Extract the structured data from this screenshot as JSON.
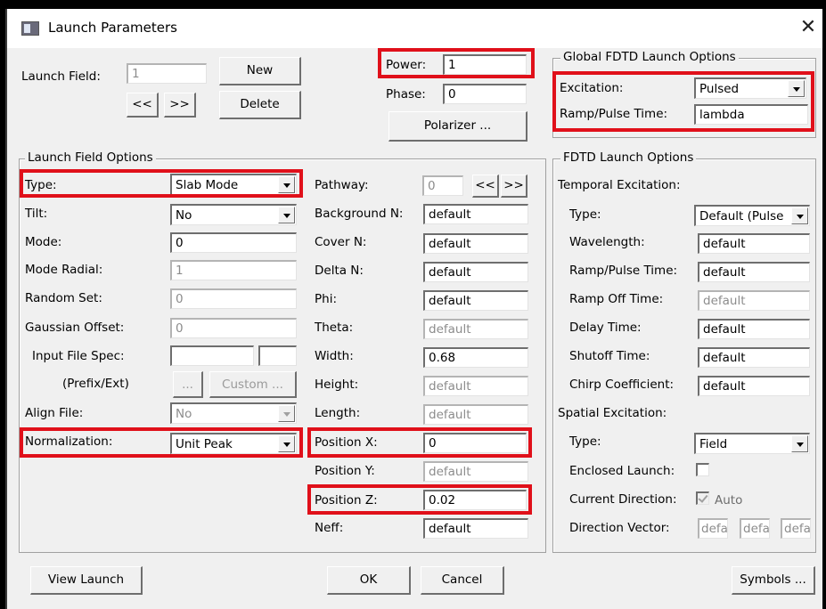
{
  "window": {
    "title": "Launch Parameters",
    "close_symbol": "✕"
  },
  "launch": {
    "field_label": "Launch Field:",
    "field_value": "1",
    "new_label": "New",
    "delete_label": "Delete",
    "prev_label": "<<",
    "next_label": ">>"
  },
  "power": {
    "label": "Power:",
    "value": "1"
  },
  "phase": {
    "label": "Phase:",
    "value": "0"
  },
  "polarizer_label": "Polarizer ...",
  "global_fdtd": {
    "title": "Global FDTD Launch Options",
    "excitation_label": "Excitation:",
    "excitation_value": "Pulsed",
    "ramp_label": "Ramp/Pulse Time:",
    "ramp_value": "lambda"
  },
  "lfo": {
    "title": "Launch Field Options",
    "type_label": "Type:",
    "type_value": "Slab Mode",
    "tilt_label": "Tilt:",
    "tilt_value": "No",
    "mode_label": "Mode:",
    "mode_value": "0",
    "mode_radial_label": "Mode Radial:",
    "mode_radial_value": "1",
    "random_set_label": "Random Set:",
    "random_set_value": "0",
    "gaussian_offset_label": "Gaussian Offset:",
    "gaussian_offset_value": "0",
    "input_file_label": "Input File Spec:",
    "prefix_ext_label": "(Prefix/Ext)",
    "ellipsis_label": "...",
    "custom_label": "Custom ...",
    "align_file_label": "Align File:",
    "align_file_value": "No",
    "normalization_label": "Normalization:",
    "normalization_value": "Unit Peak",
    "pathway_label": "Pathway:",
    "pathway_value": "0",
    "pathway_prev": "<<",
    "pathway_next": ">>",
    "background_n_label": "Background N:",
    "background_n_value": "default",
    "cover_n_label": "Cover N:",
    "cover_n_value": "default",
    "delta_n_label": "Delta N:",
    "delta_n_value": "default",
    "phi_label": "Phi:",
    "phi_value": "default",
    "theta_label": "Theta:",
    "theta_value": "default",
    "width_label": "Width:",
    "width_value": "0.68",
    "height_label": "Height:",
    "height_value": "default",
    "length_label": "Length:",
    "length_value": "default",
    "position_x_label": "Position X:",
    "position_x_value": "0",
    "position_y_label": "Position Y:",
    "position_y_value": "default",
    "position_z_label": "Position Z:",
    "position_z_value": "0.02",
    "neff_label": "Neff:",
    "neff_value": "default"
  },
  "fdtd": {
    "title": "FDTD Launch Options",
    "temporal_label": "Temporal Excitation:",
    "t_type_label": "Type:",
    "t_type_value": "Default (Pulse",
    "wavelength_label": "Wavelength:",
    "wavelength_value": "default",
    "ramp_pulse_label": "Ramp/Pulse Time:",
    "ramp_pulse_value": "default",
    "ramp_off_label": "Ramp Off Time:",
    "ramp_off_value": "default",
    "delay_label": "Delay Time:",
    "delay_value": "default",
    "shutoff_label": "Shutoff Time:",
    "shutoff_value": "default",
    "chirp_label": "Chirp Coefficient:",
    "chirp_value": "default",
    "spatial_label": "Spatial Excitation:",
    "s_type_label": "Type:",
    "s_type_value": "Field",
    "enclosed_label": "Enclosed Launch:",
    "current_dir_label": "Current Direction:",
    "auto_label": "Auto",
    "dir_vector_label": "Direction Vector:",
    "dir_vector_values": [
      "defa",
      "defa",
      "defa"
    ]
  },
  "footer": {
    "view_launch_label": "View Launch",
    "ok_label": "OK",
    "cancel_label": "Cancel",
    "symbols_label": "Symbols ..."
  },
  "colors": {
    "highlight": "#e0101a",
    "dialog_bg": "#f0f0f0"
  }
}
